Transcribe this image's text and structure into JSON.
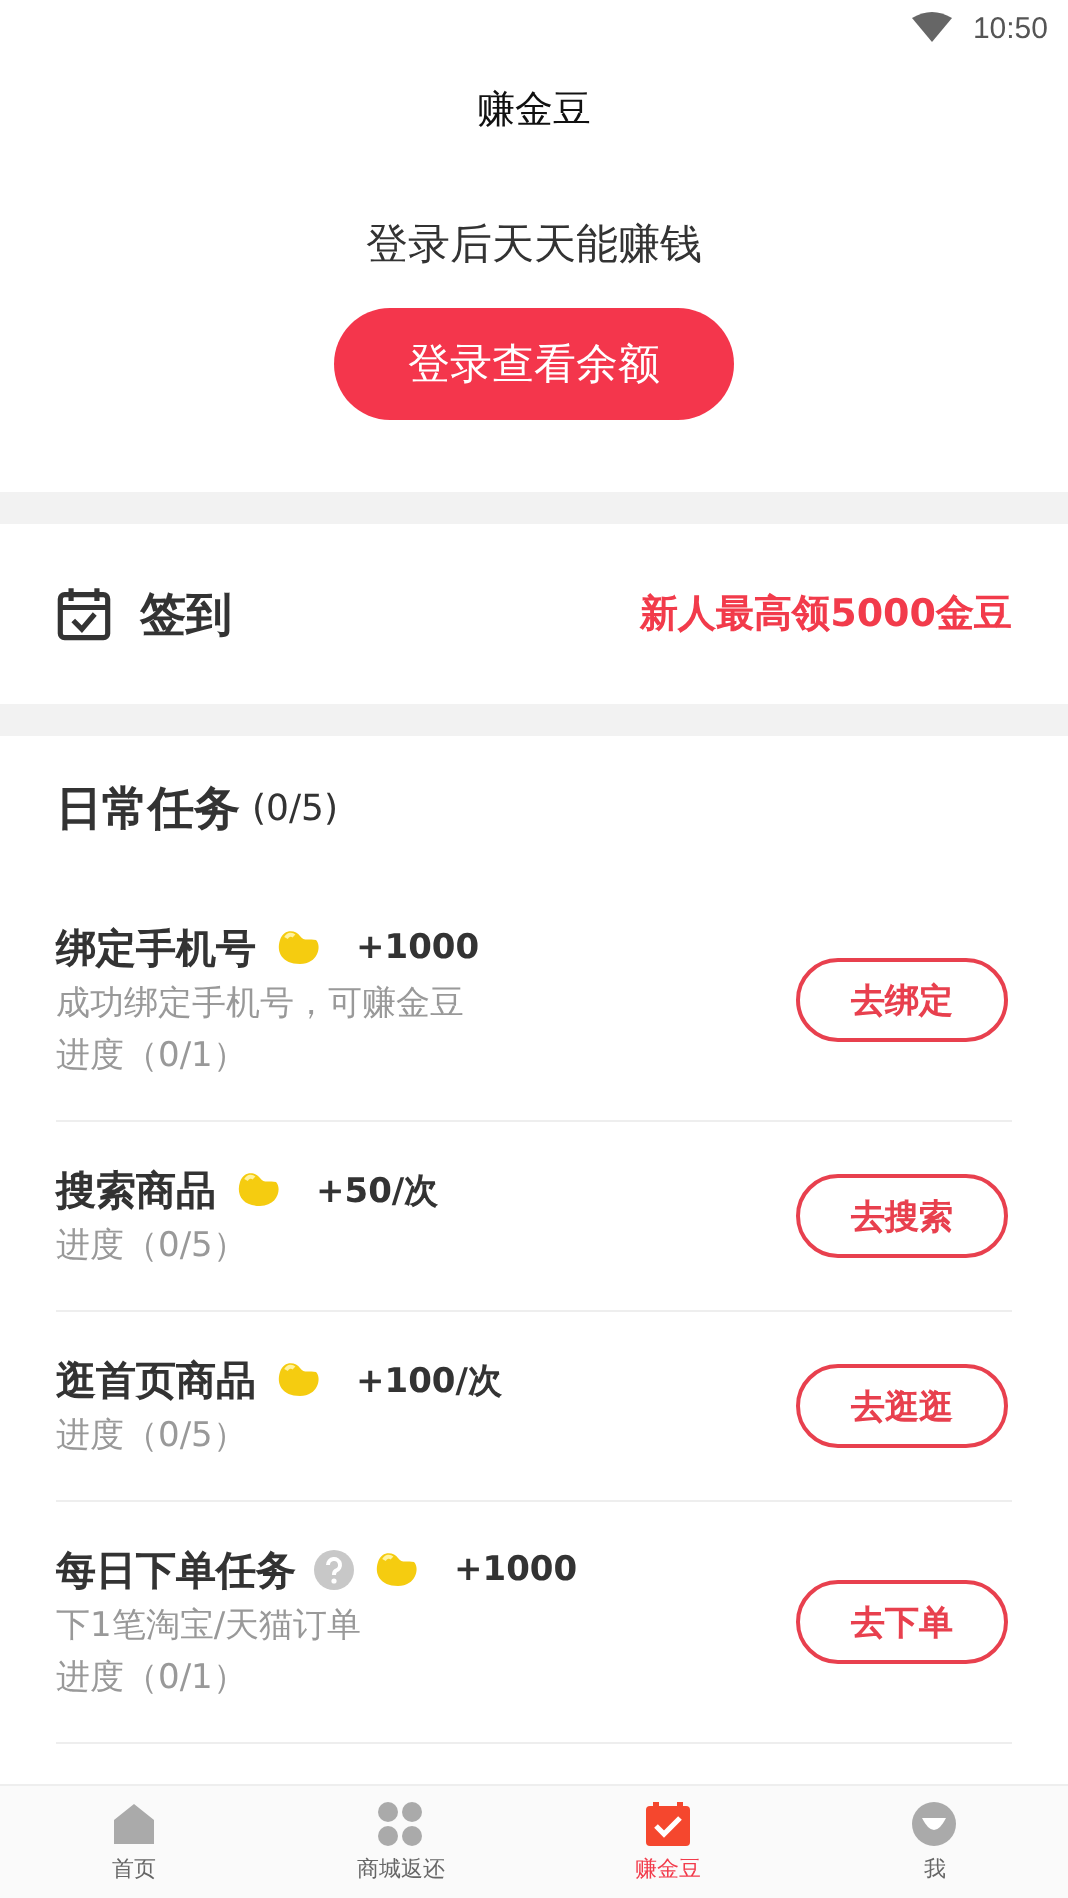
{
  "status_bar": {
    "time": "10:50"
  },
  "header": {
    "title": "赚金豆",
    "prompt": "登录后天天能赚钱",
    "login_button": "登录查看余额"
  },
  "checkin": {
    "label": "签到",
    "promo": "新人最高领5000金豆"
  },
  "daily_tasks": {
    "title": "日常任务",
    "count": "(0/5)",
    "tasks": [
      {
        "title": "绑定手机号",
        "help": false,
        "reward": "+1000",
        "description": "成功绑定手机号，可赚金豆",
        "progress": "进度（0/1）",
        "button": "去绑定"
      },
      {
        "title": "搜索商品",
        "help": false,
        "reward": "+50/次",
        "progress": "进度（0/5）",
        "button": "去搜索"
      },
      {
        "title": "逛首页商品",
        "help": false,
        "reward": "+100/次",
        "progress": "进度（0/5）",
        "button": "去逛逛"
      },
      {
        "title": "每日下单任务",
        "help": true,
        "reward": "+1000",
        "description": "下1笔淘宝/天猫订单",
        "progress": "进度（0/1）",
        "button": "去下单"
      }
    ]
  },
  "tab_bar": [
    {
      "label": "首页",
      "selected": false
    },
    {
      "label": "商城返还",
      "selected": false
    },
    {
      "label": "赚金豆",
      "selected": true
    },
    {
      "label": "我",
      "selected": false
    }
  ]
}
